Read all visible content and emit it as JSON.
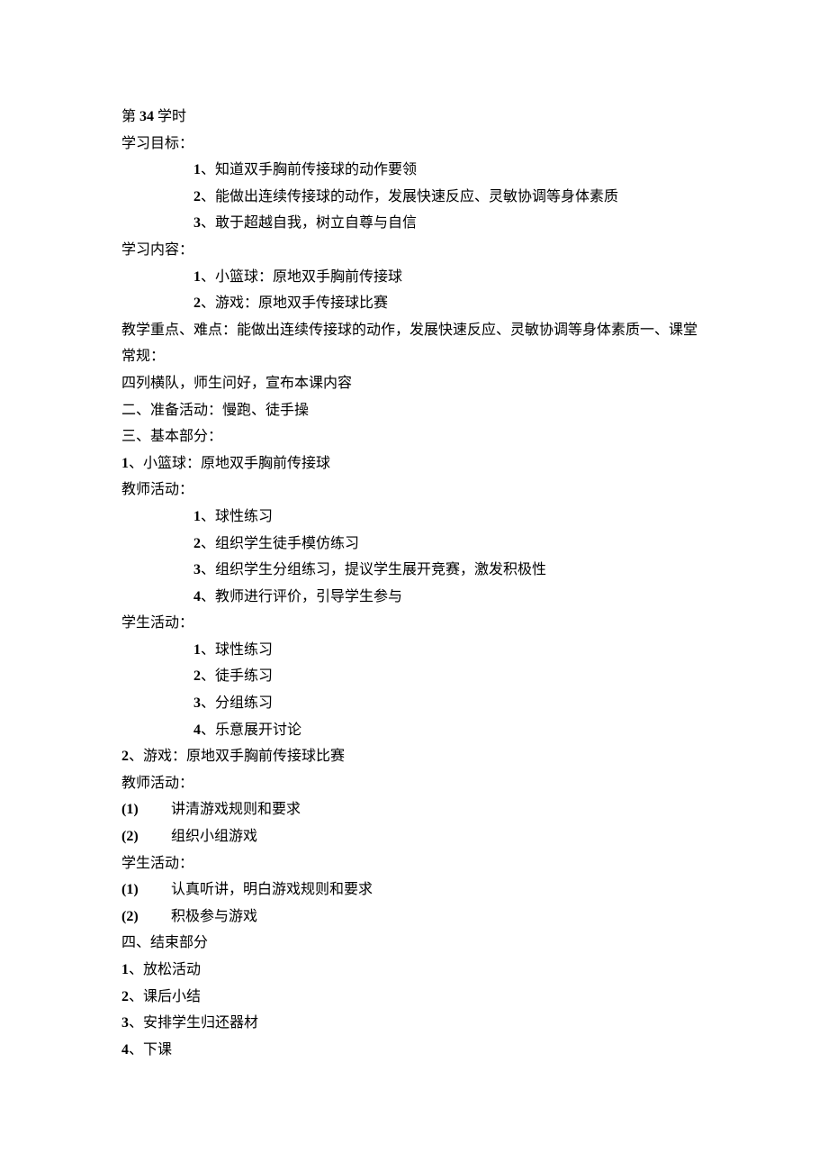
{
  "header": {
    "lesson_prefix": "第 ",
    "lesson_num": "34",
    "lesson_suffix": " 学时"
  },
  "objectives": {
    "label": "学习目标：",
    "items": [
      {
        "num": "1",
        "text": "、知道双手胸前传接球的动作要领"
      },
      {
        "num": "2",
        "text": "、能做出连续传接球的动作，发展快速反应、灵敏协调等身体素质"
      },
      {
        "num": "3",
        "text": "、敢于超越自我，树立自尊与自信"
      }
    ]
  },
  "content": {
    "label": "学习内容：",
    "items": [
      {
        "num": "1",
        "text": "、小篮球：原地双手胸前传接球"
      },
      {
        "num": "2",
        "text": "、游戏：原地双手传接球比赛"
      }
    ]
  },
  "keypoint": "教学重点、难点：能做出连续传接球的动作，发展快速反应、灵敏协调等身体素质一、课堂常规：",
  "routine": "四列横队，师生问好，宣布本课内容",
  "warmup": "二、准备活动：慢跑、徒手操",
  "main_label": "三、基本部分：",
  "main1": {
    "title": {
      "num": "1",
      "text": "、小篮球：原地双手胸前传接球"
    },
    "teacher_label": "教师活动：",
    "teacher_items": [
      {
        "num": "1",
        "text": "、球性练习"
      },
      {
        "num": "2",
        "text": "、组织学生徒手模仿练习"
      },
      {
        "num": "3",
        "text": "、组织学生分组练习，提议学生展开竞赛，激发积极性"
      },
      {
        "num": "4",
        "text": "、教师进行评价，引导学生参与"
      }
    ],
    "student_label": "学生活动：",
    "student_items": [
      {
        "num": "1",
        "text": "、球性练习"
      },
      {
        "num": "2",
        "text": "、徒手练习"
      },
      {
        "num": "3",
        "text": "、分组练习"
      },
      {
        "num": "4",
        "text": "、乐意展开讨论"
      }
    ]
  },
  "main2": {
    "title": {
      "num": "2",
      "text": "、游戏：原地双手胸前传接球比赛"
    },
    "teacher_label": "教师活动：",
    "teacher_items": [
      {
        "num": "(1)",
        "text": "讲清游戏规则和要求"
      },
      {
        "num": "(2)",
        "text": "组织小组游戏"
      }
    ],
    "student_label": "学生活动：",
    "student_items": [
      {
        "num": "(1)",
        "text": "认真听讲，明白游戏规则和要求"
      },
      {
        "num": "(2)",
        "text": "积极参与游戏"
      }
    ]
  },
  "ending": {
    "label": "四、结束部分",
    "items": [
      {
        "num": "1",
        "text": "、放松活动"
      },
      {
        "num": "2",
        "text": "、课后小结"
      },
      {
        "num": "3",
        "text": "、安排学生归还器材"
      },
      {
        "num": "4",
        "text": "、下课"
      }
    ]
  }
}
